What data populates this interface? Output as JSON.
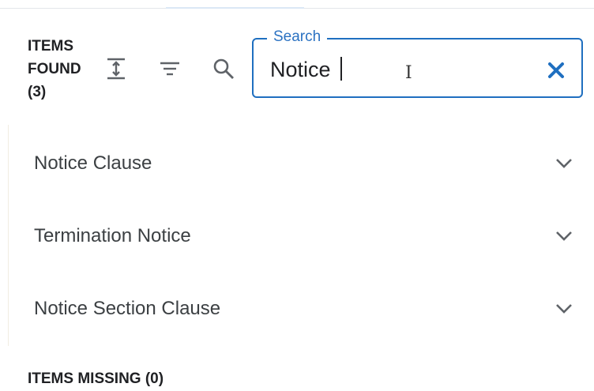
{
  "header": {
    "items_found_line1": "ITEMS",
    "items_found_line2": "FOUND",
    "items_found_count": "(3)"
  },
  "toolbar": {
    "icons": [
      "expand-collapse-icon",
      "filter-icon",
      "search-icon"
    ]
  },
  "search": {
    "legend": "Search",
    "value": "Notice",
    "clear_icon": "close-icon"
  },
  "results": [
    {
      "label": "Notice Clause",
      "icon": "chevron-down-icon"
    },
    {
      "label": "Termination Notice",
      "icon": "chevron-down-icon"
    },
    {
      "label": "Notice Section Clause",
      "icon": "chevron-down-icon"
    }
  ],
  "footer": {
    "items_missing": "ITEMS MISSING (0)"
  },
  "colors": {
    "accent": "#1f6fc0",
    "legend": "#2b72c2",
    "icon": "#5f6368",
    "text": "#3c4043"
  }
}
